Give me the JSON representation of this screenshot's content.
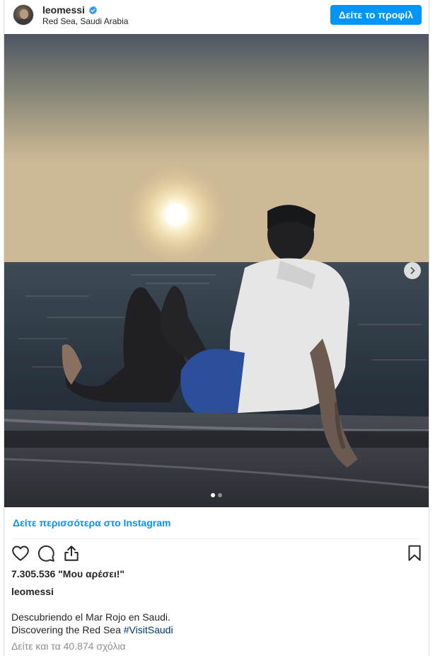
{
  "header": {
    "username": "leomessi",
    "location": "Red Sea, Saudi Arabia",
    "profile_button": "Δείτε το προφίλ"
  },
  "carousel": {
    "total_slides": 2,
    "current_slide": 1
  },
  "see_more": "Δείτε περισσότερα στο Instagram",
  "actions": {
    "likes": "7.305.536 \"Μου αρέσει!\""
  },
  "caption": {
    "username": "leomessi",
    "line1": "Descubriendo el Mar Rojo en Saudi.",
    "line2": "Discovering the Red Sea",
    "hashtag": "#VisitSaudi"
  },
  "view_comments": "Δείτε και τα 40.874 σχόλια",
  "colors": {
    "accent": "#0095f6",
    "hashtag": "#00376b",
    "muted": "#8e8e8e",
    "verified": "#3897f0"
  },
  "icons": [
    "verified-badge-icon",
    "chevron-right-icon",
    "heart-icon",
    "comment-icon",
    "share-icon",
    "bookmark-icon"
  ]
}
